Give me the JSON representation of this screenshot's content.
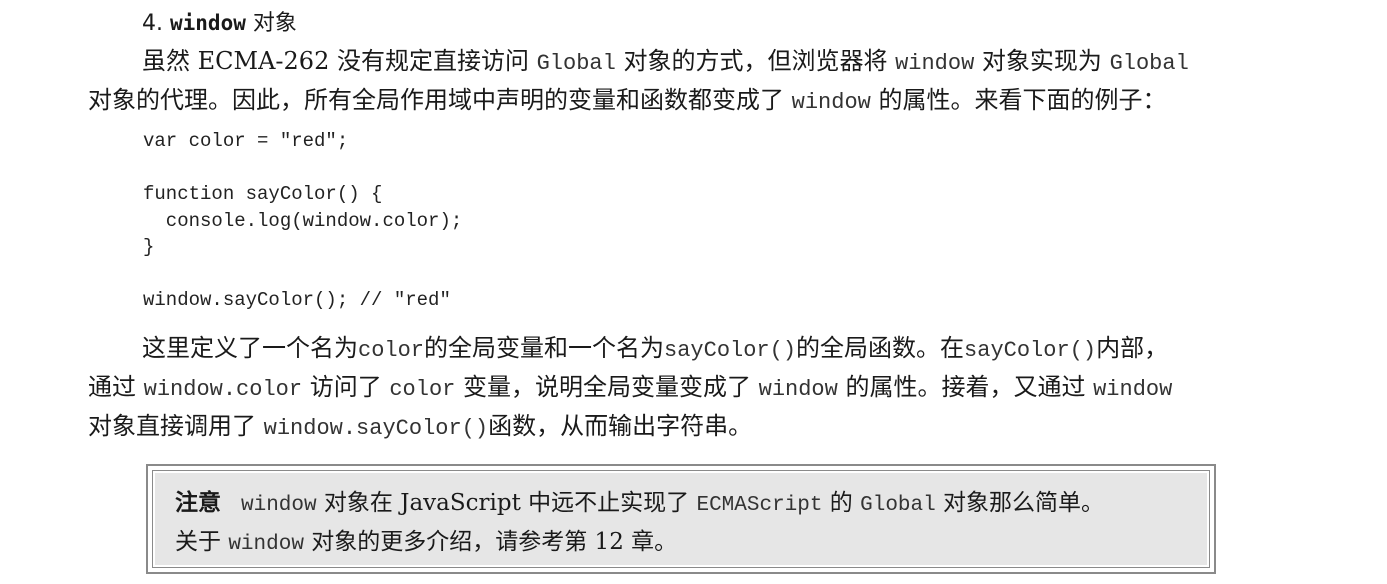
{
  "heading": {
    "number": "4.",
    "code": "window",
    "text": " 对象"
  },
  "para1": {
    "line1": [
      {
        "t": "虽然 ECMA-262 没有规定直接访问 "
      },
      {
        "t": "Global",
        "m": true
      },
      {
        "t": " 对象的方式，但浏览器将 "
      },
      {
        "t": "window",
        "m": true
      },
      {
        "t": " 对象实现为 "
      },
      {
        "t": "Global",
        "m": true
      }
    ],
    "line2": [
      {
        "t": "对象的代理。因此，所有全局作用域中声明的变量和函数都变成了 "
      },
      {
        "t": "window",
        "m": true
      },
      {
        "t": " 的属性。来看下面的例子："
      }
    ]
  },
  "code": "var color = \"red\";\n\nfunction sayColor() {\n  console.log(window.color);\n}\n\nwindow.sayColor(); // \"red\"",
  "para2": {
    "line1": [
      {
        "t": "这里定义了一个名为"
      },
      {
        "t": "color",
        "m": true
      },
      {
        "t": "的全局变量和一个名为"
      },
      {
        "t": "sayColor()",
        "m": true
      },
      {
        "t": "的全局函数。在"
      },
      {
        "t": "sayColor()",
        "m": true
      },
      {
        "t": "内部，"
      }
    ],
    "line2": [
      {
        "t": "通过 "
      },
      {
        "t": "window.color",
        "m": true
      },
      {
        "t": " 访问了 "
      },
      {
        "t": "color",
        "m": true
      },
      {
        "t": " 变量，说明全局变量变成了 "
      },
      {
        "t": "window",
        "m": true
      },
      {
        "t": " 的属性。接着，又通过 "
      },
      {
        "t": "window",
        "m": true
      }
    ],
    "line3": [
      {
        "t": "对象直接调用了 "
      },
      {
        "t": "window.sayColor()",
        "m": true
      },
      {
        "t": "函数，从而输出字符串。"
      }
    ]
  },
  "note": {
    "label": "注意",
    "line1": [
      {
        "t": "window",
        "m": true
      },
      {
        "t": " 对象在 JavaScript 中远不止实现了 "
      },
      {
        "t": "ECMAScript",
        "m": true
      },
      {
        "t": " 的 "
      },
      {
        "t": "Global",
        "m": true
      },
      {
        "t": " 对象那么简单。"
      }
    ],
    "line2": [
      {
        "t": "关于 "
      },
      {
        "t": "window",
        "m": true
      },
      {
        "t": " 对象的更多介绍，请参考第 12 章。"
      }
    ]
  }
}
